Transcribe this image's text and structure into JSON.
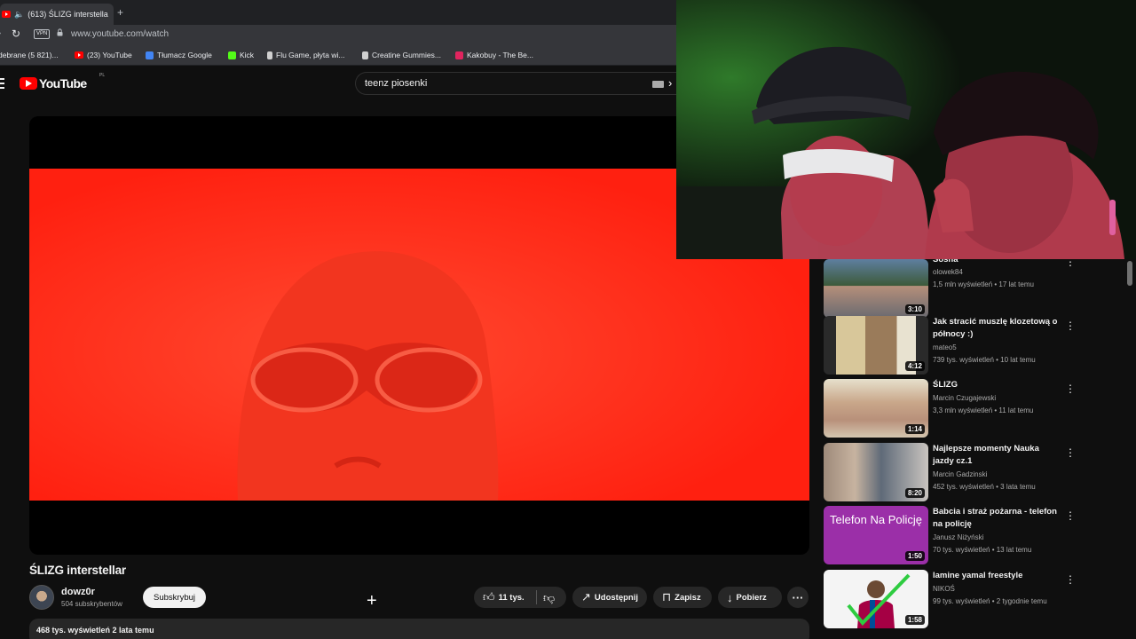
{
  "browser": {
    "tab_title": "(613) ŚLIZG interstella",
    "new_tab_symbol": "+",
    "vpn_badge": "VPN",
    "url": "www.youtube.com/watch",
    "bookmarks": [
      {
        "label": "debrane (5 821)...",
        "icon": "inbox-icon",
        "color": "#ea4335"
      },
      {
        "label": "(23) YouTube",
        "icon": "youtube-icon",
        "color": "#ff0000"
      },
      {
        "label": "Tłumacz Google",
        "icon": "translate-icon",
        "color": "#4285f4"
      },
      {
        "label": "Kick",
        "icon": "kick-icon",
        "color": "#53fc18"
      },
      {
        "label": "Flu Game, płyta wi...",
        "icon": "bookmark-site-icon",
        "color": "#d0d0d0"
      },
      {
        "label": "Creatine Gummies...",
        "icon": "bookmark-site-icon",
        "color": "#d0d0d0"
      },
      {
        "label": "Kakobuy - The Be...",
        "icon": "kakobuy-icon",
        "color": "#e0245e"
      }
    ]
  },
  "youtube": {
    "logo_text": "YouTube",
    "country_code": "PL",
    "search_query": "teenz piosenki"
  },
  "video": {
    "title": "ŚLIZG interstellar",
    "channel": "dowz0r",
    "subscribers": "504 subskrybentów",
    "subscribe_label": "Subskrybuj",
    "likes": "11 tys.",
    "share_label": "Udostępnij",
    "save_label": "Zapisz",
    "download_label": "Pobierz",
    "stats": "468 tys. wyświetleń  2 lata temu"
  },
  "sidebar": [
    {
      "title": "Sosna",
      "channel": "olowek84",
      "meta": "1,5 mln wyświetleń • 17 lat temu",
      "duration": "3:10"
    },
    {
      "title": "Jak stracić muszlę klozetową o północy :)",
      "channel": "mateo5",
      "meta": "739 tys. wyświetleń • 10 lat temu",
      "duration": "4:12"
    },
    {
      "title": "ŚLIZG",
      "channel": "Marcin Czugajewski",
      "meta": "3,3 mln wyświetleń • 11 lat temu",
      "duration": "1:14"
    },
    {
      "title": "Najlepsze momenty Nauka jazdy cz.1",
      "channel": "Marcin Gadzinski",
      "meta": "452 tys. wyświetleń • 3 lata temu",
      "duration": "8:20"
    },
    {
      "title": "Babcia i straż pożarna - telefon na policję",
      "channel": "Janusz Niżyński",
      "meta": "70 tys. wyświetleń • 13 lat temu",
      "duration": "1:50",
      "thumb_text": "Telefon Na Policję"
    },
    {
      "title": "lamine yamal freestyle",
      "channel": "NIKOŚ",
      "meta": "99 tys. wyświetleń • 2 tygodnie temu",
      "duration": "1:58"
    }
  ]
}
